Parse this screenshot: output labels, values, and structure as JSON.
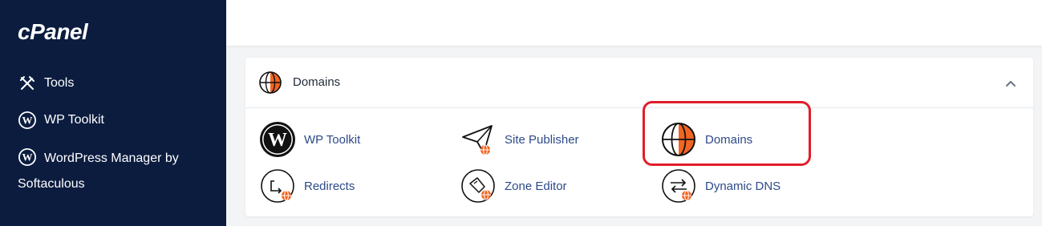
{
  "sidebar": {
    "logo": "cPanel",
    "items": [
      {
        "label": "Tools",
        "icon": "tools-icon"
      },
      {
        "label": "WP Toolkit",
        "icon": "wordpress-icon"
      },
      {
        "label": "WordPress Manager by Softaculous",
        "icon": "wordpress-icon"
      }
    ]
  },
  "panel": {
    "title": "Domains",
    "icon": "globe-icon",
    "collapse_icon": "chevron-up-icon",
    "tools": [
      {
        "label": "WP Toolkit",
        "icon": "wordpress-icon"
      },
      {
        "label": "Site Publisher",
        "icon": "paper-plane-icon"
      },
      {
        "label": "Domains",
        "icon": "globe-icon"
      },
      {
        "label": "Redirects",
        "icon": "redirect-icon"
      },
      {
        "label": "Zone Editor",
        "icon": "zone-editor-icon"
      },
      {
        "label": "Dynamic DNS",
        "icon": "dynamic-dns-icon"
      }
    ]
  },
  "colors": {
    "sidebar_bg": "#0b1c3f",
    "link": "#2d4a8a",
    "accent_orange": "#f26522",
    "highlight_red": "#e11d2a"
  }
}
